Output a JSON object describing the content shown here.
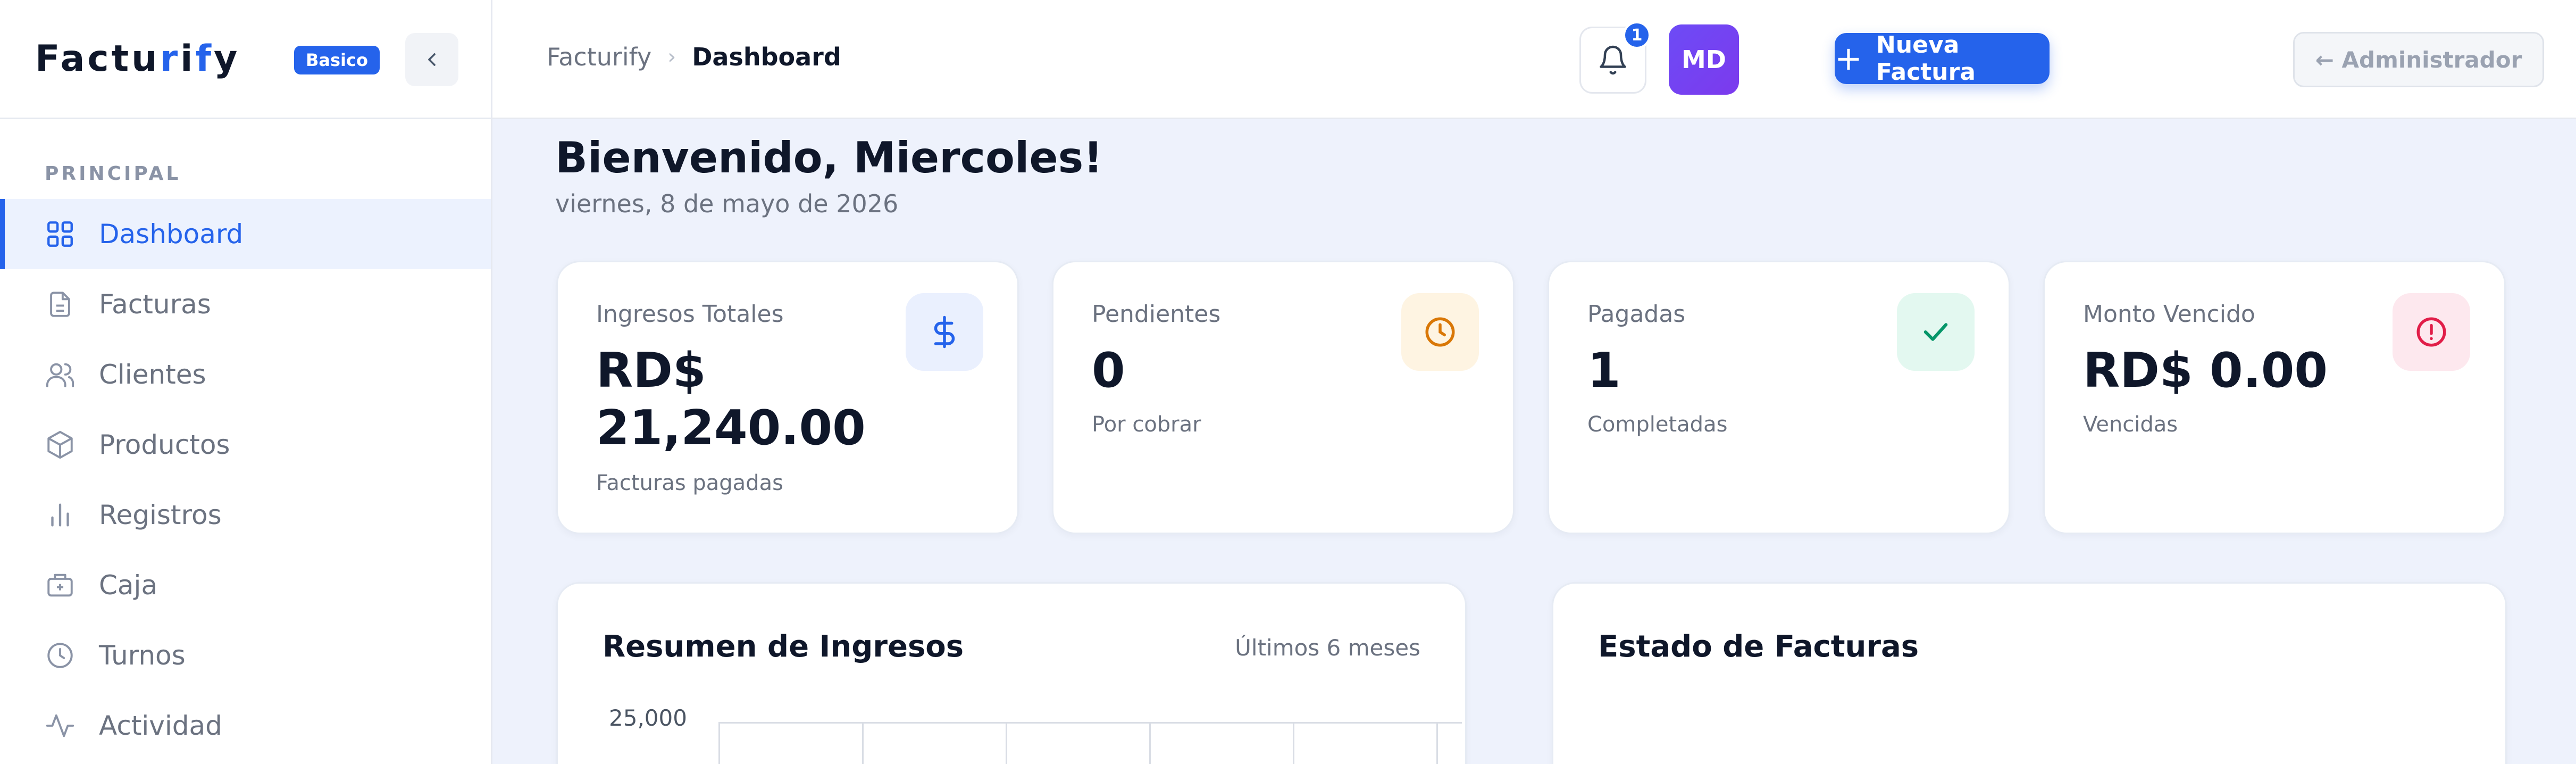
{
  "brand": {
    "name_pre": "Factu",
    "name_accent1": "r",
    "name_mid": "i",
    "name_accent2": "f",
    "name_post": "y",
    "plan_badge": "Basico"
  },
  "sidebar": {
    "section_label": "PRINCIPAL",
    "items": [
      {
        "label": "Dashboard",
        "icon": "grid-icon",
        "active": true
      },
      {
        "label": "Facturas",
        "icon": "document-icon"
      },
      {
        "label": "Clientes",
        "icon": "users-icon"
      },
      {
        "label": "Productos",
        "icon": "box-icon"
      },
      {
        "label": "Registros",
        "icon": "bar-chart-icon"
      },
      {
        "label": "Caja",
        "icon": "cash-register-icon"
      },
      {
        "label": "Turnos",
        "icon": "clock-icon"
      },
      {
        "label": "Actividad",
        "icon": "activity-icon"
      }
    ]
  },
  "header": {
    "breadcrumb_root": "Facturify",
    "breadcrumb_separator": "›",
    "breadcrumb_current": "Dashboard",
    "new_invoice_label": "Nueva Factura",
    "notification_count": "1",
    "avatar_initials": "MD",
    "admin_button_label": "← Administrador"
  },
  "main": {
    "welcome": "Bienvenido, Miercoles!",
    "date": "viernes, 8 de mayo de 2026",
    "stats": [
      {
        "title": "Ingresos Totales",
        "value": "RD$ 21,240.00",
        "sub": "Facturas pagadas",
        "icon": "dollar-icon",
        "color": "#2563eb"
      },
      {
        "title": "Pendientes",
        "value": "0",
        "sub": "Por cobrar",
        "icon": "clock-icon",
        "color": "#d97706"
      },
      {
        "title": "Pagadas",
        "value": "1",
        "sub": "Completadas",
        "icon": "check-icon",
        "color": "#059669"
      },
      {
        "title": "Monto Vencido",
        "value": "RD$ 0.00",
        "sub": "Vencidas",
        "icon": "alert-circle-icon",
        "color": "#e11d48"
      }
    ],
    "revenue_panel": {
      "title": "Resumen de Ingresos",
      "range": "Últimos 6 meses",
      "y_tick_top": "25,000"
    },
    "status_panel": {
      "title": "Estado de Facturas"
    }
  },
  "colors": {
    "primary": "#2563eb",
    "avatar": "#6d4bf6",
    "background": "#eef2fc"
  }
}
